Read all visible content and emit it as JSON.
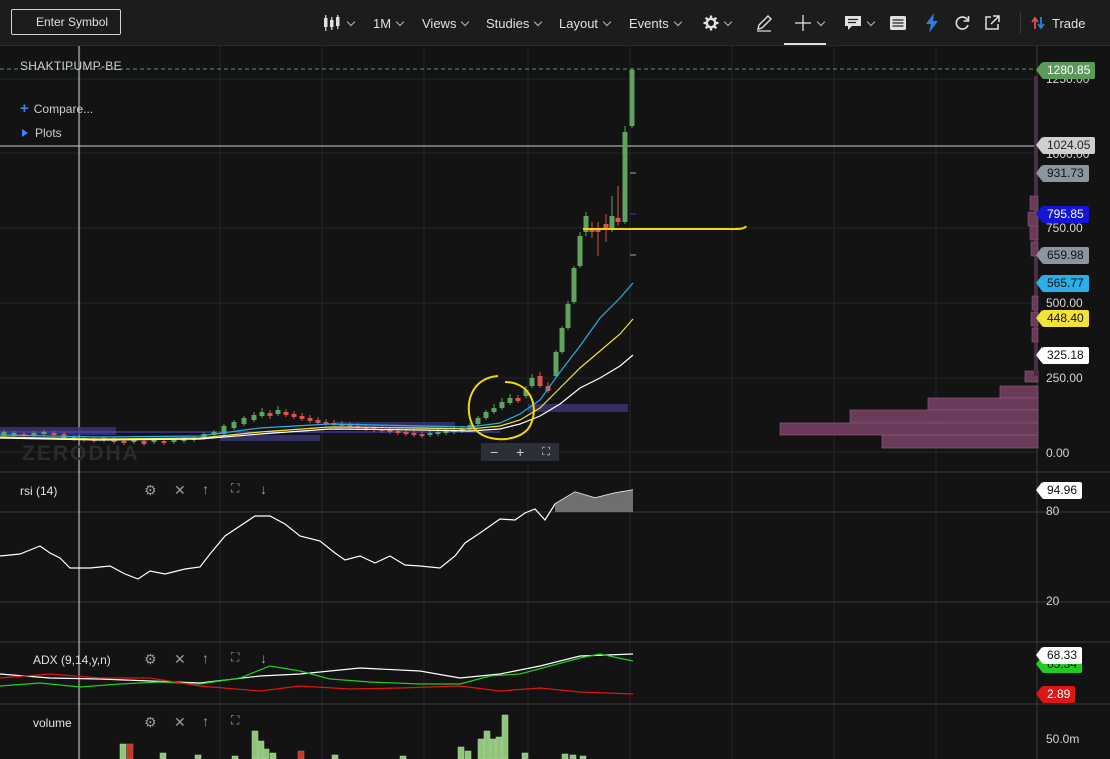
{
  "toolbar": {
    "search_placeholder": "Enter Symbol",
    "interval": "1M",
    "views": "Views",
    "studies": "Studies",
    "layout": "Layout",
    "events": "Events",
    "trade": "Trade"
  },
  "chart": {
    "symbol": "SHAKTIPUMP-BE",
    "compare": "Compare...",
    "plots": "Plots",
    "watermark": "ZERODHA",
    "y_axis_ticks": [
      "1250.00",
      "1000.00",
      "750.00",
      "500.00",
      "250.00",
      "0.00"
    ],
    "price_tags": [
      {
        "value": "1280.85",
        "bg": "#5b9a5b",
        "fg": "#ffffff"
      },
      {
        "value": "1024.05",
        "bg": "#cfcfcf",
        "fg": "#222222"
      },
      {
        "value": "931.73",
        "bg": "#8b96a3",
        "fg": "#111111"
      },
      {
        "value": "795.85",
        "bg": "#1515d6",
        "fg": "#ffffff"
      },
      {
        "value": "659.98",
        "bg": "#8b96a3",
        "fg": "#111111"
      },
      {
        "value": "565.77",
        "bg": "#29aee8",
        "fg": "#111111"
      },
      {
        "value": "448.40",
        "bg": "#f2e23a",
        "fg": "#111111"
      },
      {
        "value": "325.18",
        "bg": "#ffffff",
        "fg": "#111111"
      }
    ]
  },
  "panels": {
    "rsi": {
      "label": "rsi (14)",
      "tag": "94.96",
      "ticks": [
        "80",
        "20"
      ]
    },
    "adx": {
      "label": "ADX (9,14,y,n)",
      "tag_white": "68.33",
      "tag_green": "65.34",
      "tag_red": "2.89"
    },
    "volume": {
      "label": "volume",
      "tick": "50.0m"
    }
  },
  "colors": {
    "up": "#5fa35f",
    "down": "#d9534f",
    "ma_blue": "#29aee8",
    "ma_yellow": "#f2e23a",
    "ma_white": "#ffffff",
    "hline": "#f2d60f",
    "profile": "#6b3a5a"
  }
}
